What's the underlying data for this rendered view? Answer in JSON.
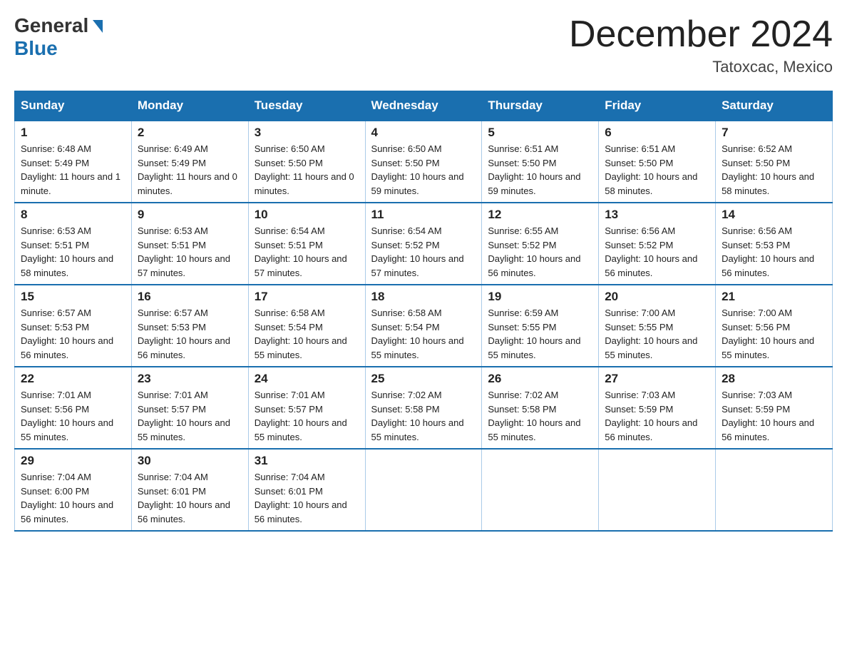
{
  "header": {
    "logo_general": "General",
    "logo_blue": "Blue",
    "title": "December 2024",
    "location": "Tatoxcac, Mexico"
  },
  "days_of_week": [
    "Sunday",
    "Monday",
    "Tuesday",
    "Wednesday",
    "Thursday",
    "Friday",
    "Saturday"
  ],
  "weeks": [
    [
      {
        "day": "1",
        "sunrise": "6:48 AM",
        "sunset": "5:49 PM",
        "daylight": "11 hours and 1 minute."
      },
      {
        "day": "2",
        "sunrise": "6:49 AM",
        "sunset": "5:49 PM",
        "daylight": "11 hours and 0 minutes."
      },
      {
        "day": "3",
        "sunrise": "6:50 AM",
        "sunset": "5:50 PM",
        "daylight": "11 hours and 0 minutes."
      },
      {
        "day": "4",
        "sunrise": "6:50 AM",
        "sunset": "5:50 PM",
        "daylight": "10 hours and 59 minutes."
      },
      {
        "day": "5",
        "sunrise": "6:51 AM",
        "sunset": "5:50 PM",
        "daylight": "10 hours and 59 minutes."
      },
      {
        "day": "6",
        "sunrise": "6:51 AM",
        "sunset": "5:50 PM",
        "daylight": "10 hours and 58 minutes."
      },
      {
        "day": "7",
        "sunrise": "6:52 AM",
        "sunset": "5:50 PM",
        "daylight": "10 hours and 58 minutes."
      }
    ],
    [
      {
        "day": "8",
        "sunrise": "6:53 AM",
        "sunset": "5:51 PM",
        "daylight": "10 hours and 58 minutes."
      },
      {
        "day": "9",
        "sunrise": "6:53 AM",
        "sunset": "5:51 PM",
        "daylight": "10 hours and 57 minutes."
      },
      {
        "day": "10",
        "sunrise": "6:54 AM",
        "sunset": "5:51 PM",
        "daylight": "10 hours and 57 minutes."
      },
      {
        "day": "11",
        "sunrise": "6:54 AM",
        "sunset": "5:52 PM",
        "daylight": "10 hours and 57 minutes."
      },
      {
        "day": "12",
        "sunrise": "6:55 AM",
        "sunset": "5:52 PM",
        "daylight": "10 hours and 56 minutes."
      },
      {
        "day": "13",
        "sunrise": "6:56 AM",
        "sunset": "5:52 PM",
        "daylight": "10 hours and 56 minutes."
      },
      {
        "day": "14",
        "sunrise": "6:56 AM",
        "sunset": "5:53 PM",
        "daylight": "10 hours and 56 minutes."
      }
    ],
    [
      {
        "day": "15",
        "sunrise": "6:57 AM",
        "sunset": "5:53 PM",
        "daylight": "10 hours and 56 minutes."
      },
      {
        "day": "16",
        "sunrise": "6:57 AM",
        "sunset": "5:53 PM",
        "daylight": "10 hours and 56 minutes."
      },
      {
        "day": "17",
        "sunrise": "6:58 AM",
        "sunset": "5:54 PM",
        "daylight": "10 hours and 55 minutes."
      },
      {
        "day": "18",
        "sunrise": "6:58 AM",
        "sunset": "5:54 PM",
        "daylight": "10 hours and 55 minutes."
      },
      {
        "day": "19",
        "sunrise": "6:59 AM",
        "sunset": "5:55 PM",
        "daylight": "10 hours and 55 minutes."
      },
      {
        "day": "20",
        "sunrise": "7:00 AM",
        "sunset": "5:55 PM",
        "daylight": "10 hours and 55 minutes."
      },
      {
        "day": "21",
        "sunrise": "7:00 AM",
        "sunset": "5:56 PM",
        "daylight": "10 hours and 55 minutes."
      }
    ],
    [
      {
        "day": "22",
        "sunrise": "7:01 AM",
        "sunset": "5:56 PM",
        "daylight": "10 hours and 55 minutes."
      },
      {
        "day": "23",
        "sunrise": "7:01 AM",
        "sunset": "5:57 PM",
        "daylight": "10 hours and 55 minutes."
      },
      {
        "day": "24",
        "sunrise": "7:01 AM",
        "sunset": "5:57 PM",
        "daylight": "10 hours and 55 minutes."
      },
      {
        "day": "25",
        "sunrise": "7:02 AM",
        "sunset": "5:58 PM",
        "daylight": "10 hours and 55 minutes."
      },
      {
        "day": "26",
        "sunrise": "7:02 AM",
        "sunset": "5:58 PM",
        "daylight": "10 hours and 55 minutes."
      },
      {
        "day": "27",
        "sunrise": "7:03 AM",
        "sunset": "5:59 PM",
        "daylight": "10 hours and 56 minutes."
      },
      {
        "day": "28",
        "sunrise": "7:03 AM",
        "sunset": "5:59 PM",
        "daylight": "10 hours and 56 minutes."
      }
    ],
    [
      {
        "day": "29",
        "sunrise": "7:04 AM",
        "sunset": "6:00 PM",
        "daylight": "10 hours and 56 minutes."
      },
      {
        "day": "30",
        "sunrise": "7:04 AM",
        "sunset": "6:01 PM",
        "daylight": "10 hours and 56 minutes."
      },
      {
        "day": "31",
        "sunrise": "7:04 AM",
        "sunset": "6:01 PM",
        "daylight": "10 hours and 56 minutes."
      },
      null,
      null,
      null,
      null
    ]
  ]
}
